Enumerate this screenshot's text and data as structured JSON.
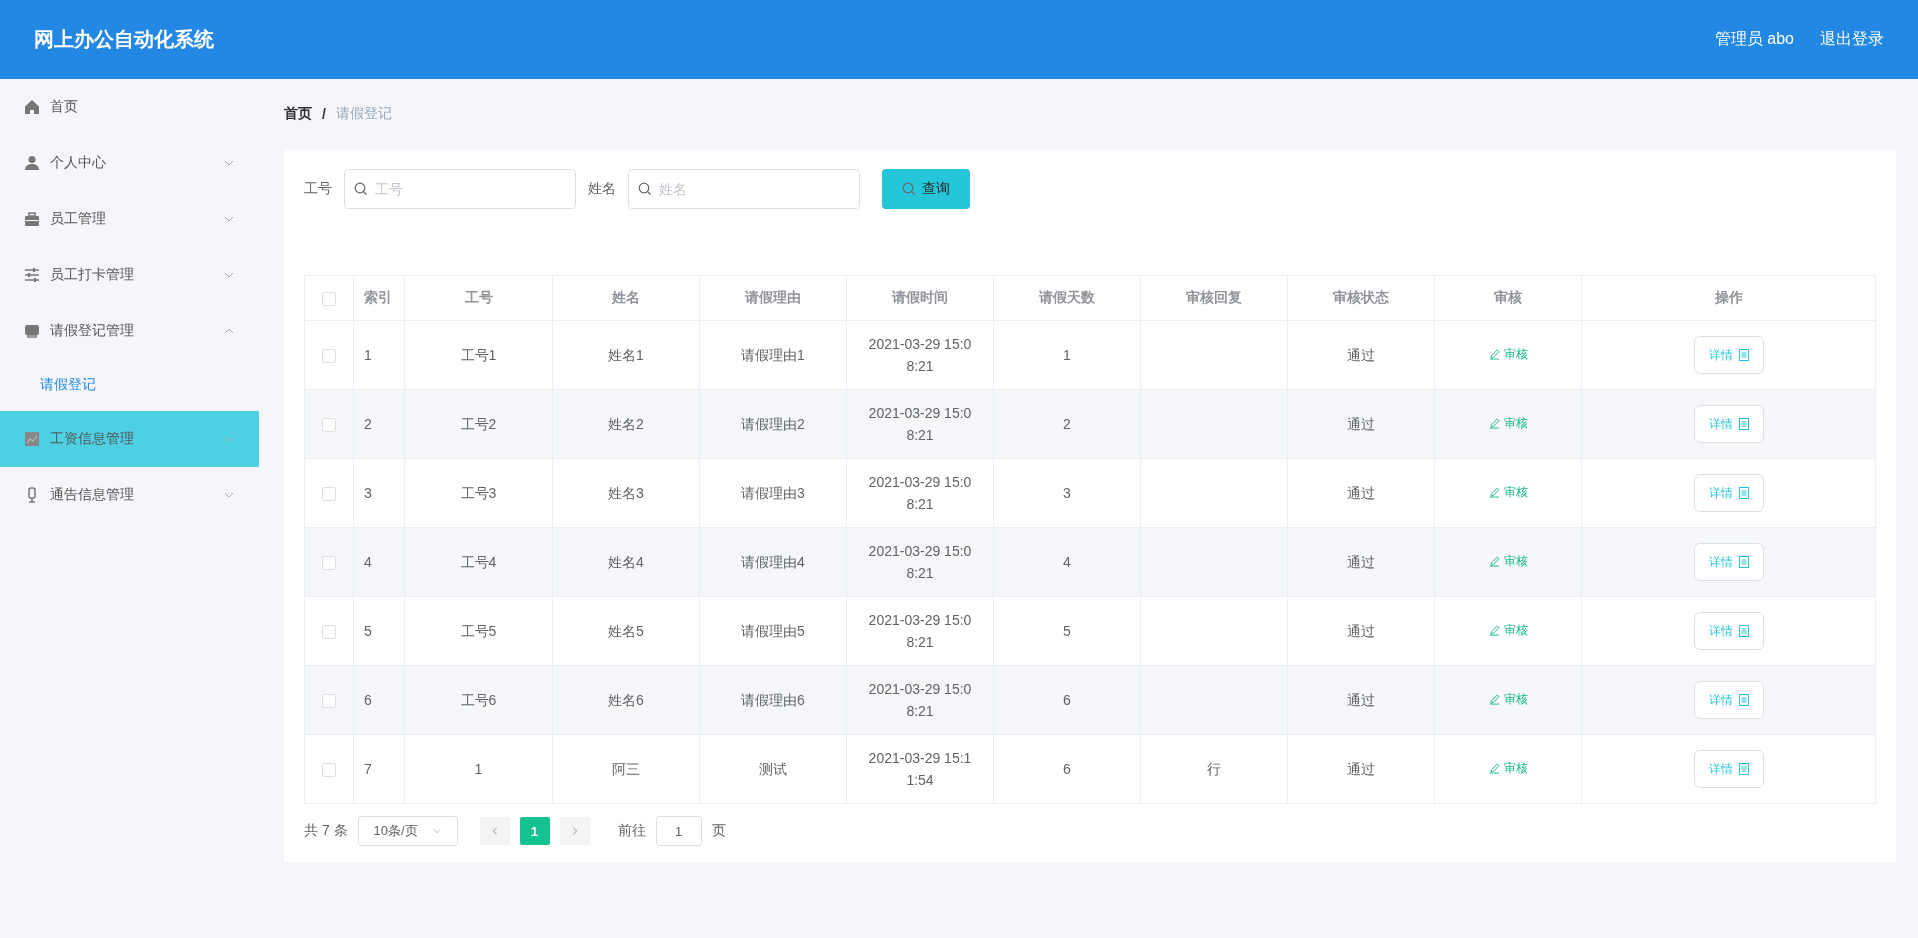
{
  "header": {
    "title": "网上办公自动化系统",
    "user": "管理员 abo",
    "logout": "退出登录"
  },
  "sidebar": {
    "items": [
      {
        "kind": "link",
        "label": "首页",
        "highlighted": false
      },
      {
        "kind": "menu",
        "label": "个人中心",
        "expanded": false,
        "highlighted": false
      },
      {
        "kind": "menu",
        "label": "员工管理",
        "expanded": false,
        "highlighted": false
      },
      {
        "kind": "menu",
        "label": "员工打卡管理",
        "expanded": false,
        "highlighted": false
      },
      {
        "kind": "menu",
        "label": "请假登记管理",
        "expanded": true,
        "highlighted": false,
        "children": [
          {
            "label": "请假登记",
            "selected": true
          }
        ]
      },
      {
        "kind": "menu",
        "label": "工资信息管理",
        "expanded": false,
        "highlighted": true
      },
      {
        "kind": "menu",
        "label": "通告信息管理",
        "expanded": false,
        "highlighted": false
      }
    ]
  },
  "breadcrumb": {
    "items": [
      "首页",
      "请假登记"
    ],
    "separator": "/"
  },
  "filters": [
    {
      "label": "工号",
      "placeholder": "工号"
    },
    {
      "label": "姓名",
      "placeholder": "姓名"
    }
  ],
  "search_button": "查询",
  "table": {
    "select_all_checked": false,
    "columns": [
      "索引",
      "工号",
      "姓名",
      "请假理由",
      "请假时间",
      "请假天数",
      "审核回复",
      "审核状态",
      "审核",
      "操作"
    ],
    "rows": [
      {
        "checked": false,
        "cells": [
          "1",
          "工号1",
          "姓名1",
          "请假理由1",
          "2021-03-29 15:08:21",
          "1",
          "",
          "通过"
        ],
        "review": "审核",
        "detail": "详情"
      },
      {
        "checked": false,
        "cells": [
          "2",
          "工号2",
          "姓名2",
          "请假理由2",
          "2021-03-29 15:08:21",
          "2",
          "",
          "通过"
        ],
        "review": "审核",
        "detail": "详情"
      },
      {
        "checked": false,
        "cells": [
          "3",
          "工号3",
          "姓名3",
          "请假理由3",
          "2021-03-29 15:08:21",
          "3",
          "",
          "通过"
        ],
        "review": "审核",
        "detail": "详情"
      },
      {
        "checked": false,
        "cells": [
          "4",
          "工号4",
          "姓名4",
          "请假理由4",
          "2021-03-29 15:08:21",
          "4",
          "",
          "通过"
        ],
        "review": "审核",
        "detail": "详情"
      },
      {
        "checked": false,
        "cells": [
          "5",
          "工号5",
          "姓名5",
          "请假理由5",
          "2021-03-29 15:08:21",
          "5",
          "",
          "通过"
        ],
        "review": "审核",
        "detail": "详情"
      },
      {
        "checked": false,
        "cells": [
          "6",
          "工号6",
          "姓名6",
          "请假理由6",
          "2021-03-29 15:08:21",
          "6",
          "",
          "通过"
        ],
        "review": "审核",
        "detail": "详情"
      },
      {
        "checked": false,
        "cells": [
          "7",
          "1",
          "阿三",
          "测试",
          "2021-03-29 15:11:54",
          "6",
          "行",
          "通过"
        ],
        "review": "审核",
        "detail": "详情"
      }
    ]
  },
  "pagination": {
    "total": "共 7 条",
    "page_size": "10条/页",
    "pages": [
      {
        "label": "1",
        "selected": true
      }
    ],
    "goto_label": "前往",
    "goto_value": "1",
    "goto_suffix": "页"
  }
}
